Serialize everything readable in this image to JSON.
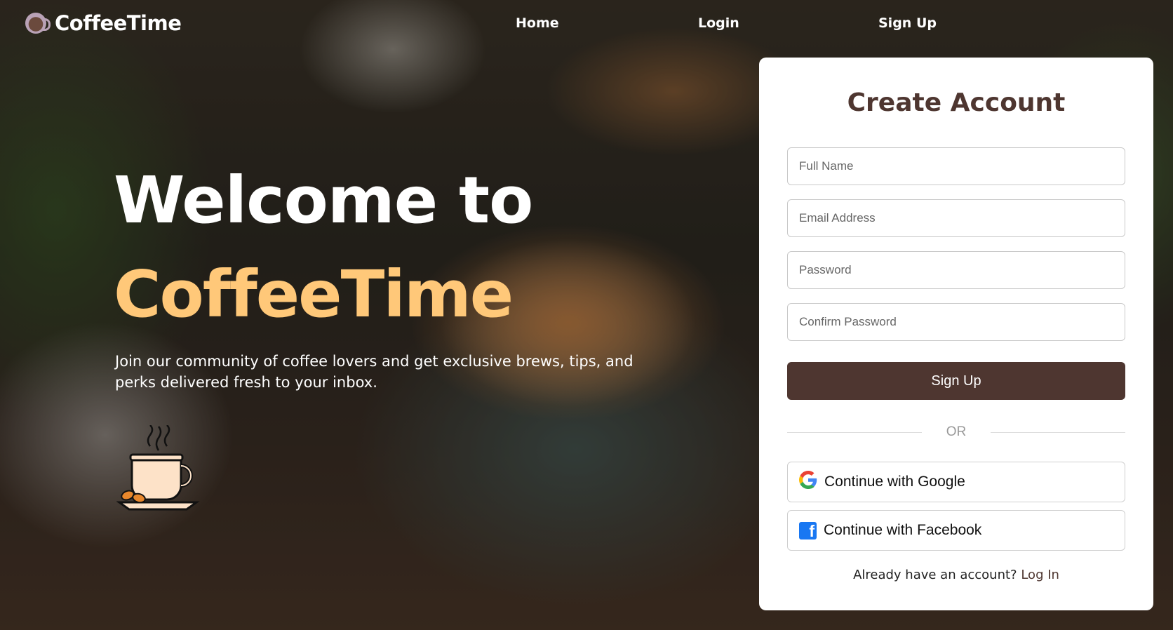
{
  "header": {
    "brand_name": "CoffeeTime",
    "brand_icon": "coffee-cup-icon",
    "nav": {
      "home": "Home",
      "login": "Login",
      "signup": "Sign Up"
    }
  },
  "hero": {
    "line1": "Welcome to",
    "line2": "CoffeeTime",
    "subtitle": "Join our community of coffee lovers and get exclusive brews, tips, and perks delivered fresh to your inbox.",
    "illustration": "steaming-coffee-cup-icon",
    "accent_color": "#ffc879"
  },
  "signup_card": {
    "title": "Create Account",
    "fields": {
      "full_name": {
        "placeholder": "Full Name",
        "value": ""
      },
      "email": {
        "placeholder": "Email Address",
        "value": ""
      },
      "password": {
        "placeholder": "Password",
        "value": ""
      },
      "confirm_password": {
        "placeholder": "Confirm Password",
        "value": ""
      }
    },
    "submit_label": "Sign Up",
    "divider_text": "OR",
    "google_label": "Continue with Google",
    "facebook_label": "Continue with Facebook",
    "footer_prompt": "Already have an account?",
    "footer_link": "Log In",
    "primary_color": "#4e3630"
  }
}
